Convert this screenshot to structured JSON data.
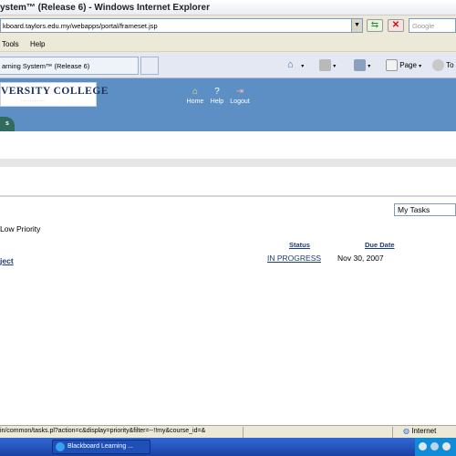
{
  "window": {
    "title": "ystem™ (Release 6) - Windows Internet Explorer"
  },
  "browser": {
    "address": "kboard.taylors.edu.my/webapps/portal/frameset.jsp",
    "search_placeholder": "Google",
    "menu": [
      "Tools",
      "Help"
    ],
    "tab_label": "arning System™ (Release 6)",
    "commands": {
      "page": "Page",
      "tools": "To"
    }
  },
  "portal": {
    "logo_text": "VERSITY COLLEGE",
    "logo_subtext": "· · · · · · · · · · ·",
    "nav": [
      "Home",
      "Help",
      "Logout"
    ],
    "tab_label": "s"
  },
  "tasks": {
    "view_select": "My Tasks",
    "priority_label": "Low Priority",
    "columns": {
      "status": "Status",
      "due_date": "Due Date"
    },
    "rows": [
      {
        "name": "ject",
        "status": "IN PROGRESS",
        "due": "Nov 30, 2007"
      }
    ]
  },
  "statusbar": {
    "url": "in/common/tasks.pl?action=c&display=priority&filter=--!!my&course_id=&",
    "zone": "Internet"
  },
  "taskbar": {
    "button": "Blackboard Learning ..."
  },
  "colors": {
    "header_blue": "#5e8fc4",
    "link_blue": "#1d3b76",
    "tab_green": "#2f6b5e"
  }
}
